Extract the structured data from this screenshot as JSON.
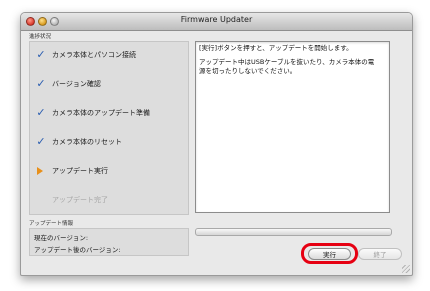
{
  "window": {
    "title": "Firmware Updater"
  },
  "progress": {
    "label": "進捗状況",
    "steps": [
      {
        "label": "カメラ本体とパソコン接続",
        "status": "done",
        "icon": "check-icon"
      },
      {
        "label": "バージョン確認",
        "status": "done",
        "icon": "check-icon"
      },
      {
        "label": "カメラ本体のアップデート準備",
        "status": "done",
        "icon": "check-icon"
      },
      {
        "label": "カメラ本体のリセット",
        "status": "done",
        "icon": "check-icon"
      },
      {
        "label": "アップデート実行",
        "status": "current",
        "icon": "play-arrow-icon"
      },
      {
        "label": "アップデート完了",
        "status": "pending",
        "icon": ""
      }
    ]
  },
  "message": {
    "line1": "[実行]ボタンを押すと、アップデートを開始します。",
    "line2": "アップデート中はUSBケーブルを抜いたり、カメラ本体の電源を切ったりしないでください。"
  },
  "update_info": {
    "label": "アップデート情報",
    "current_version": "現在のバージョン:",
    "new_version": "アップデート後のバージョン:"
  },
  "progress_bar": {
    "value": 0
  },
  "buttons": {
    "run": "実行",
    "finish": "終了"
  },
  "colors": {
    "check": "#2a5db0",
    "current_arrow": "#e8901a",
    "highlight": "#e60012"
  }
}
